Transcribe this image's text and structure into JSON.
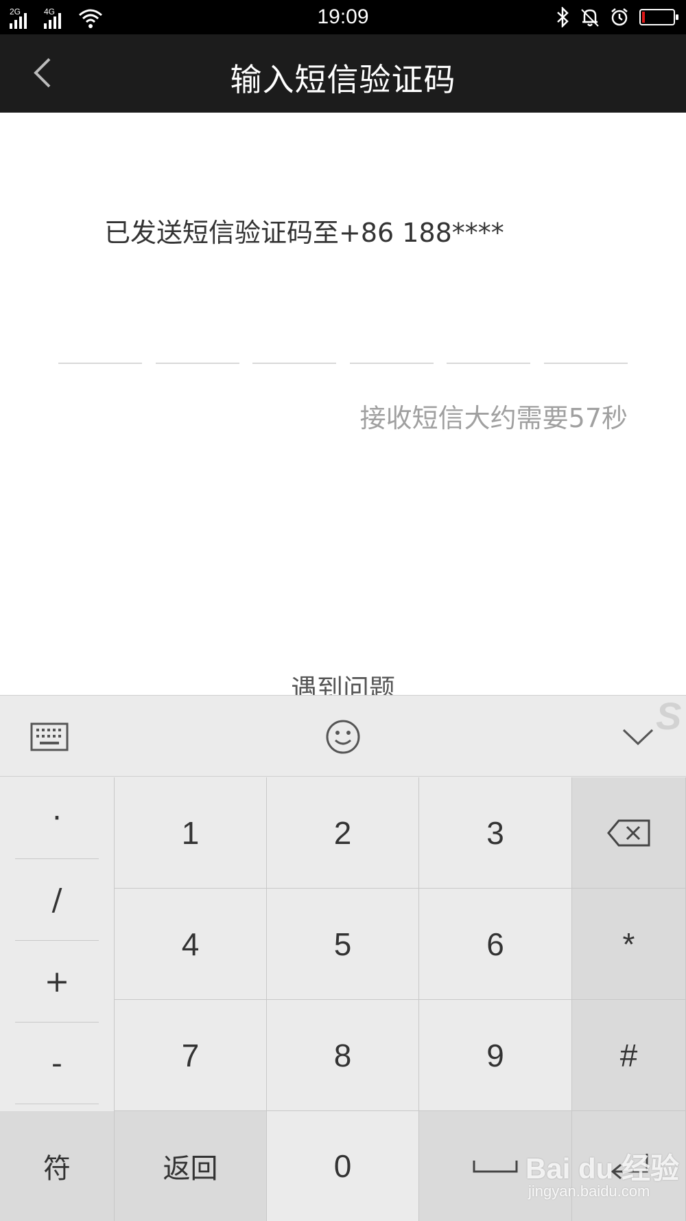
{
  "status_bar": {
    "sim1_label": "2G",
    "sim2_label": "4G",
    "time": "19:09",
    "icons": [
      "bluetooth-icon",
      "bell-icon",
      "alarm-icon",
      "battery-icon"
    ],
    "battery_color": "#e01818"
  },
  "header": {
    "back_icon": "chevron-left-icon",
    "title": "输入短信验证码"
  },
  "content": {
    "sent_message": "已发送短信验证码至+86 188****",
    "code_length": 6,
    "wait_text": "接收短信大约需要57秒",
    "problem_link": "遇到问题"
  },
  "keyboard": {
    "toolbar": {
      "left_icon": "keyboard-icon",
      "center_icon": "emoji-icon",
      "right_icon": "chevron-down-icon"
    },
    "side_keys": [
      "·",
      "/",
      "+",
      "-"
    ],
    "digits": [
      "1",
      "2",
      "3",
      "4",
      "5",
      "6",
      "7",
      "8",
      "9",
      "0"
    ],
    "right_keys": [
      "*",
      "#"
    ],
    "bottom": {
      "symbol": "符",
      "back": "返回"
    }
  },
  "watermark": {
    "brand": "Bai du 经验",
    "url": "jingyan.baidu.com",
    "corner_mark": "S"
  }
}
